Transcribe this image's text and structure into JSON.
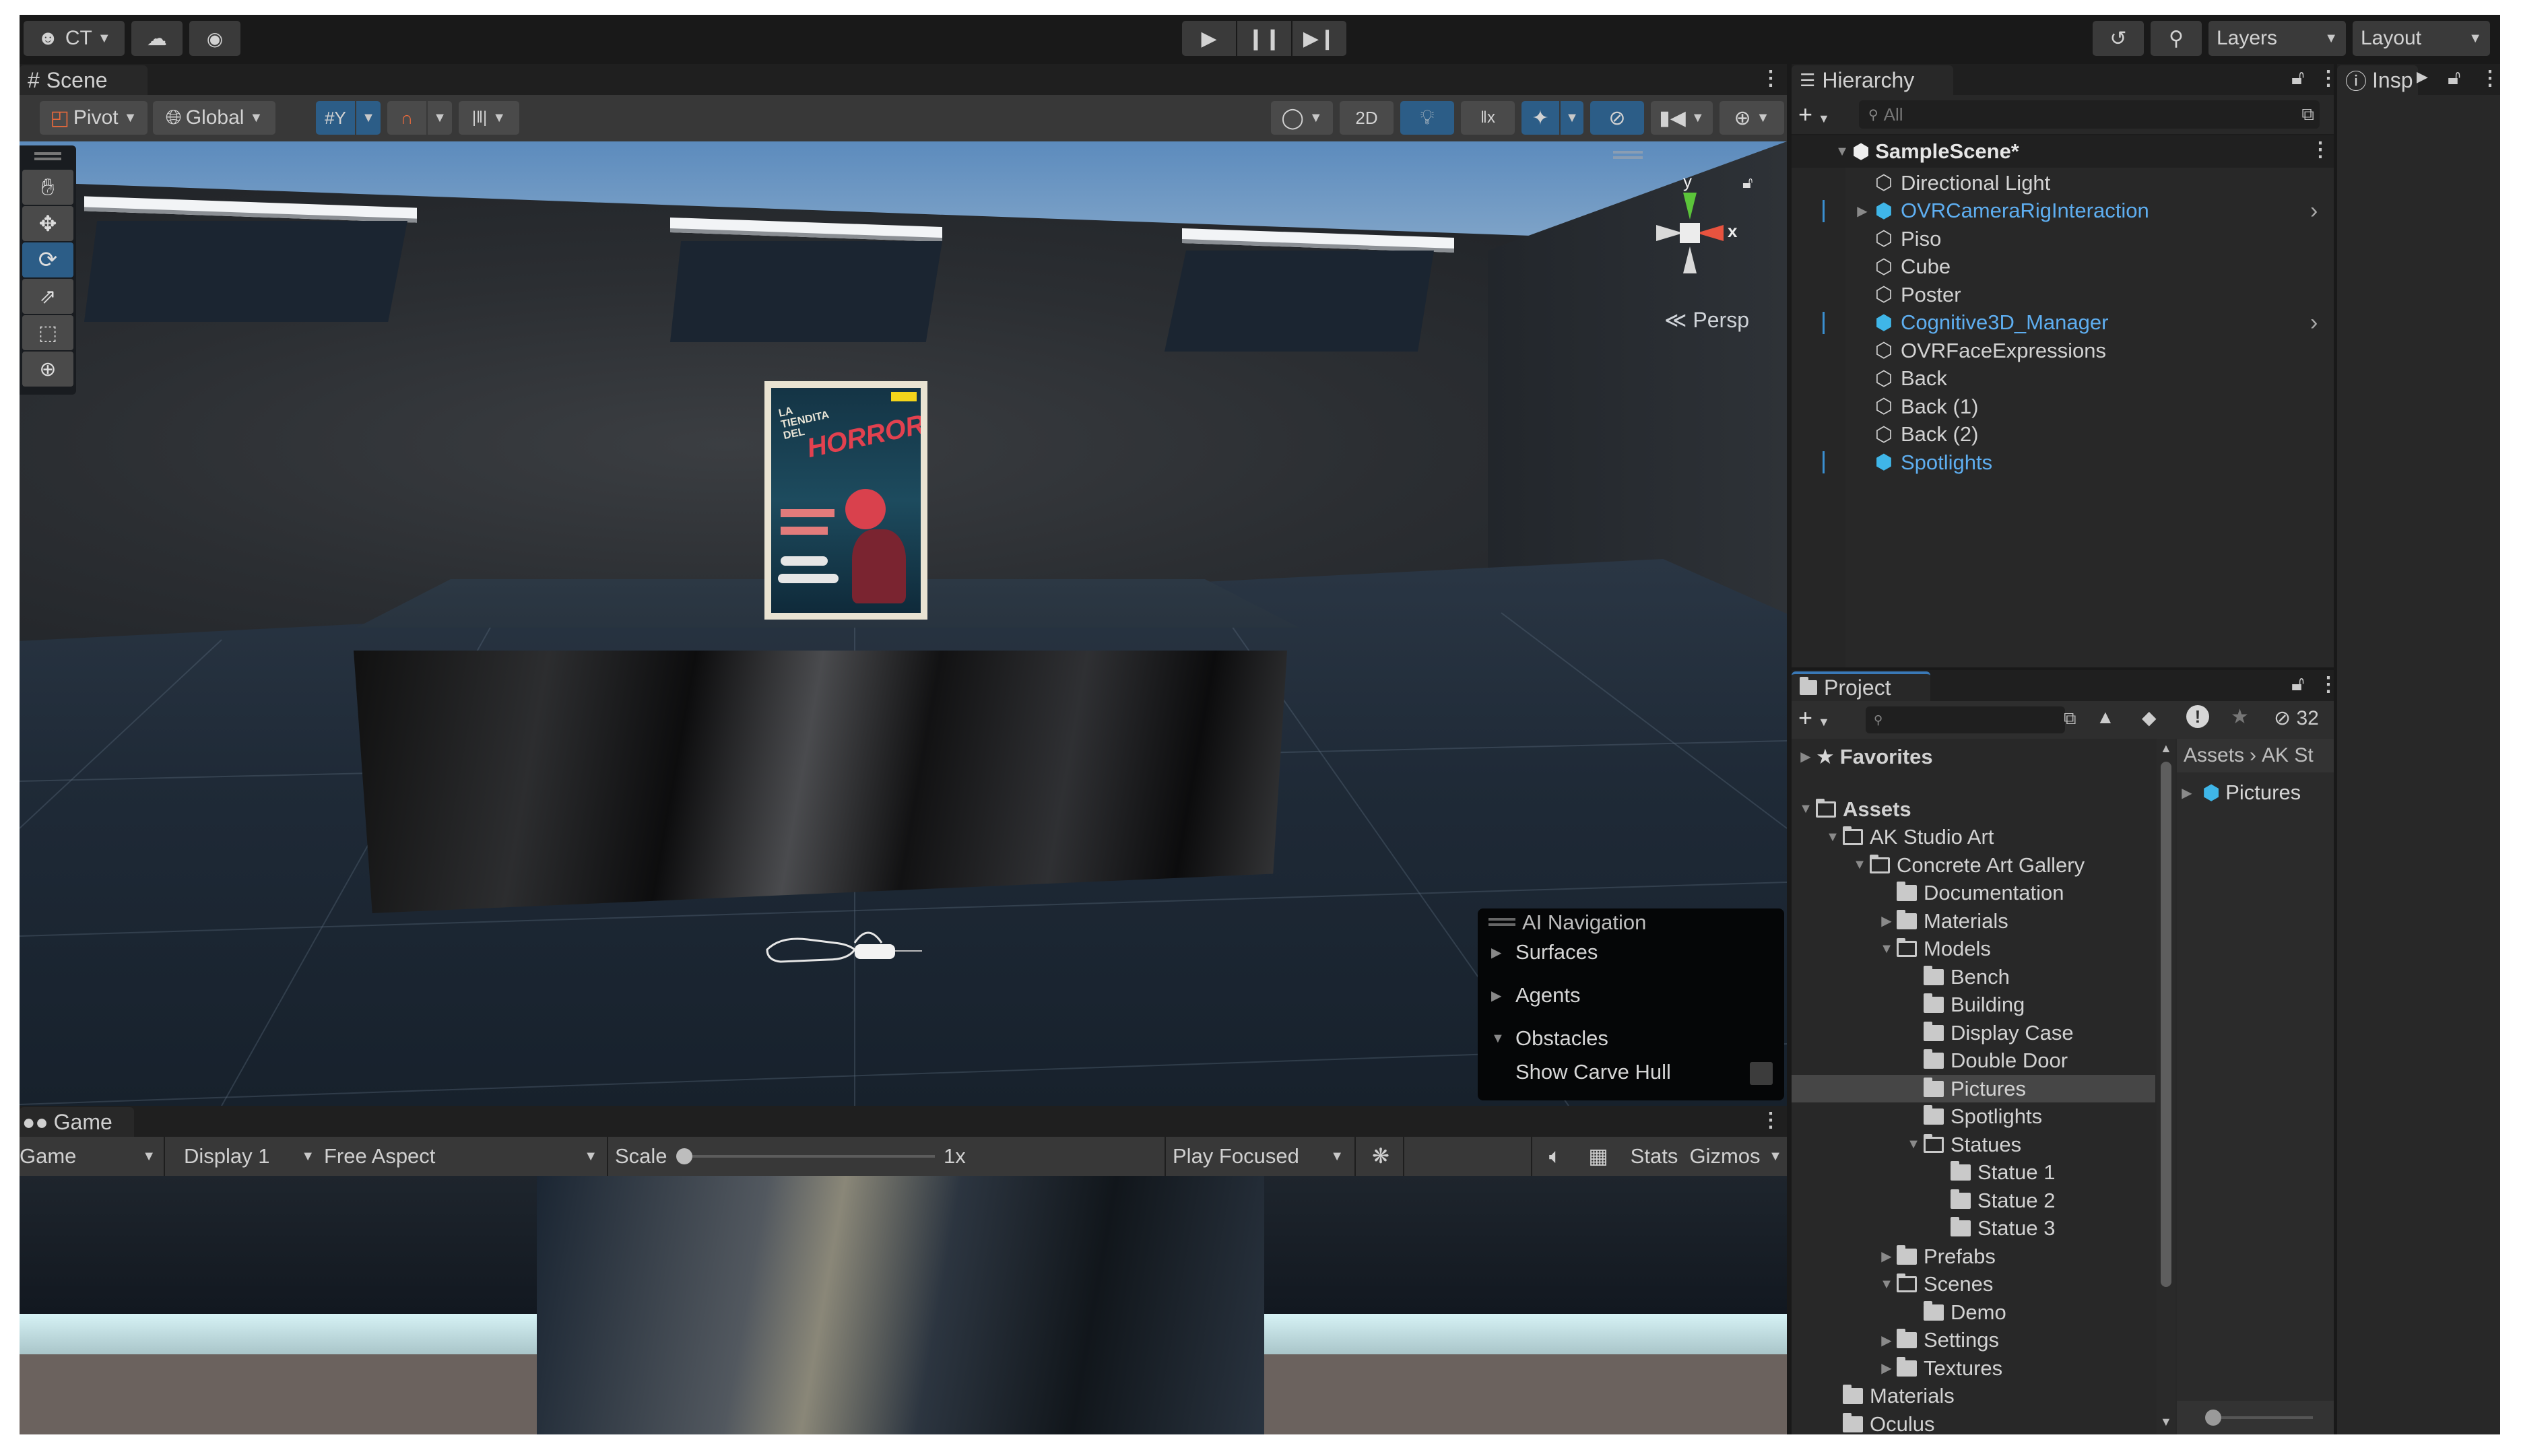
{
  "toolbar": {
    "account_label": "CT",
    "icons": [
      "account-icon",
      "cloud-icon",
      "collab-icon"
    ],
    "play_controls": [
      "play",
      "pause",
      "step"
    ],
    "history_icon": "history-icon",
    "search_icon": "search-icon",
    "layers_label": "Layers",
    "layout_label": "Layout"
  },
  "scene": {
    "tab_label": "Scene",
    "pivot_label": "Pivot",
    "global_label": "Global",
    "two_d_label": "2D",
    "persp_label": "Persp",
    "gizmo_axes": {
      "y": "y",
      "x": "x"
    },
    "tools": [
      "hand",
      "move",
      "rotate",
      "scale",
      "rect",
      "transform"
    ],
    "active_tool": "rotate",
    "poster_text": {
      "line1": "LA",
      "line2": "TIENDITA",
      "line3": "DEL",
      "line4": "HORROR"
    },
    "ai_navigation": {
      "title": "AI Navigation",
      "items": [
        {
          "label": "Surfaces",
          "expanded": false
        },
        {
          "label": "Agents",
          "expanded": false
        },
        {
          "label": "Obstacles",
          "expanded": true
        }
      ],
      "show_carve_hull_label": "Show Carve Hull",
      "show_carve_hull_checked": false
    }
  },
  "game": {
    "tab_label": "Game",
    "mode_label": "Game",
    "display_label": "Display 1",
    "aspect_label": "Free Aspect",
    "scale_label": "Scale",
    "scale_value": "1x",
    "play_focused_label": "Play Focused",
    "stats_label": "Stats",
    "gizmos_label": "Gizmos"
  },
  "hierarchy": {
    "tab_label": "Hierarchy",
    "search_placeholder": "All",
    "scene_name": "SampleScene*",
    "items": [
      {
        "label": "Directional Light",
        "prefab": false,
        "expandable": false
      },
      {
        "label": "OVRCameraRigInteraction",
        "prefab": true,
        "expandable": true
      },
      {
        "label": "Piso",
        "prefab": false,
        "expandable": false
      },
      {
        "label": "Cube",
        "prefab": false,
        "expandable": false
      },
      {
        "label": "Poster",
        "prefab": false,
        "expandable": false
      },
      {
        "label": "Cognitive3D_Manager",
        "prefab": true,
        "expandable": false
      },
      {
        "label": "OVRFaceExpressions",
        "prefab": false,
        "expandable": false
      },
      {
        "label": "Back",
        "prefab": false,
        "expandable": false
      },
      {
        "label": "Back (1)",
        "prefab": false,
        "expandable": false
      },
      {
        "label": "Back (2)",
        "prefab": false,
        "expandable": false
      },
      {
        "label": "Spotlights",
        "prefab": true,
        "expandable": false
      }
    ]
  },
  "project": {
    "tab_label": "Project",
    "hidden_count": "32",
    "favorites_label": "Favorites",
    "breadcrumb": [
      "Assets",
      "AK St"
    ],
    "content_items": [
      {
        "label": "Pictures"
      }
    ],
    "tree": [
      {
        "label": "Assets",
        "depth": 0,
        "state": "open",
        "bold": true
      },
      {
        "label": "AK Studio Art",
        "depth": 1,
        "state": "open"
      },
      {
        "label": "Concrete Art Gallery",
        "depth": 2,
        "state": "open"
      },
      {
        "label": "Documentation",
        "depth": 3,
        "state": "none"
      },
      {
        "label": "Materials",
        "depth": 3,
        "state": "closed"
      },
      {
        "label": "Models",
        "depth": 3,
        "state": "open"
      },
      {
        "label": "Bench",
        "depth": 4,
        "state": "none"
      },
      {
        "label": "Building",
        "depth": 4,
        "state": "none"
      },
      {
        "label": "Display Case",
        "depth": 4,
        "state": "none"
      },
      {
        "label": "Double Door",
        "depth": 4,
        "state": "none"
      },
      {
        "label": "Pictures",
        "depth": 4,
        "state": "none",
        "selected": true
      },
      {
        "label": "Spotlights",
        "depth": 4,
        "state": "none"
      },
      {
        "label": "Statues",
        "depth": 4,
        "state": "open"
      },
      {
        "label": "Statue 1",
        "depth": 5,
        "state": "none"
      },
      {
        "label": "Statue 2",
        "depth": 5,
        "state": "none"
      },
      {
        "label": "Statue 3",
        "depth": 5,
        "state": "none"
      },
      {
        "label": "Prefabs",
        "depth": 3,
        "state": "closed"
      },
      {
        "label": "Scenes",
        "depth": 3,
        "state": "open"
      },
      {
        "label": "Demo",
        "depth": 4,
        "state": "none"
      },
      {
        "label": "Settings",
        "depth": 3,
        "state": "closed"
      },
      {
        "label": "Textures",
        "depth": 3,
        "state": "closed"
      },
      {
        "label": "Materials",
        "depth": 1,
        "state": "none"
      },
      {
        "label": "Oculus",
        "depth": 1,
        "state": "none"
      }
    ]
  },
  "inspector": {
    "tab_label": "Insp"
  },
  "colors": {
    "accent_blue": "#2c5d87",
    "prefab_blue": "#5eaef0",
    "panel_bg": "#282828",
    "toolbar_bg": "#191919",
    "gizmo_y": "#5bc43a",
    "gizmo_x": "#e8533f"
  }
}
